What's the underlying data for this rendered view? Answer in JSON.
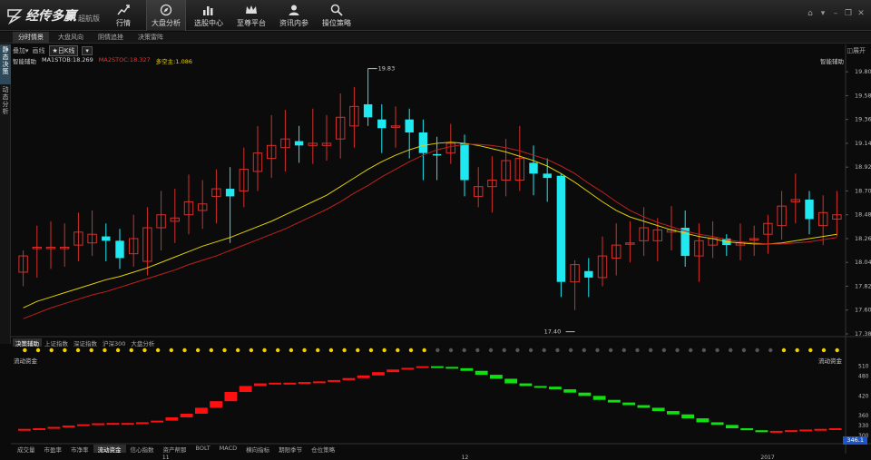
{
  "app": {
    "logo_text": "经传多赢",
    "logo_sub": "超航版"
  },
  "nav": [
    {
      "label": "行情",
      "icon": "chart-up-icon"
    },
    {
      "label": "大盘分析",
      "icon": "compass-icon"
    },
    {
      "label": "选股中心",
      "icon": "bars-icon"
    },
    {
      "label": "至尊平台",
      "icon": "crown-icon"
    },
    {
      "label": "资讯内参",
      "icon": "user-icon"
    },
    {
      "label": "操位策略",
      "icon": "search-icon"
    }
  ],
  "window_controls": [
    "home-icon",
    "menu-icon",
    "minimize-icon",
    "restore-icon",
    "close-icon"
  ],
  "subtabs": [
    "分时情景",
    "大盘风向",
    "阴情追挫",
    "决策雷阵"
  ],
  "left_tabs": [
    "静态决策",
    "动态分析"
  ],
  "toolbar": {
    "overlay": "叠加",
    "overlay_arrow": "▾",
    "lock": "画线",
    "period": "★日K线",
    "expand": "◫展开"
  },
  "indicators": {
    "label": "智能辅助",
    "ma1": "MA1STOB:18.269",
    "ma2": "MA2STOC:18.327",
    "ma3": "多空主:1.086",
    "right": "智能辅助"
  },
  "price_axis": [
    "19.80",
    "19.58",
    "19.36",
    "19.14",
    "18.92",
    "18.70",
    "18.48",
    "18.26",
    "18.04",
    "17.82",
    "17.60",
    "17.38"
  ],
  "annotations": {
    "high": "19.83",
    "low": "17.40"
  },
  "index_tabs": [
    "决策辅助",
    "上证指数",
    "深证指数",
    "沪深300",
    "大盘分析"
  ],
  "flow": {
    "label_left": "流动资金",
    "label_right": "流动资金",
    "axis": [
      "510",
      "480",
      "420",
      "360",
      "330",
      "300"
    ],
    "current": "346.1"
  },
  "time_axis": [
    "11",
    "12",
    "2017"
  ],
  "bottom_tabs": [
    "成交量",
    "市盈率",
    "市净率",
    "流动资金",
    "信心指数",
    "资产帮那",
    "BOLT",
    "MACD",
    "横向指标",
    "期限季节",
    "仓位策略"
  ],
  "colors": {
    "up": "#d4302c",
    "down": "#20e8f0",
    "ma_yellow": "#e0d000",
    "ma_red": "#c02020",
    "flow_up": "#ff1010",
    "flow_down": "#10e010"
  },
  "chart_data": {
    "type": "candlestick",
    "ylim": [
      17.38,
      19.86
    ],
    "candles": [
      [
        17.95,
        18.1,
        17.82,
        18.15
      ],
      [
        18.18,
        18.18,
        17.9,
        18.38
      ],
      [
        18.18,
        18.18,
        17.98,
        18.42
      ],
      [
        18.18,
        18.18,
        18.0,
        18.4
      ],
      [
        18.2,
        18.32,
        18.05,
        18.5
      ],
      [
        18.22,
        18.3,
        18.1,
        18.52
      ],
      [
        18.28,
        18.24,
        18.05,
        18.4
      ],
      [
        18.24,
        18.08,
        17.98,
        18.35
      ],
      [
        18.12,
        18.26,
        18.0,
        18.48
      ],
      [
        18.05,
        18.36,
        17.92,
        18.55
      ],
      [
        18.36,
        18.48,
        18.15,
        18.7
      ],
      [
        18.42,
        18.45,
        18.22,
        18.72
      ],
      [
        18.48,
        18.6,
        18.3,
        18.85
      ],
      [
        18.52,
        18.58,
        18.35,
        18.8
      ],
      [
        18.65,
        18.72,
        18.4,
        18.9
      ],
      [
        18.72,
        18.65,
        18.22,
        18.92
      ],
      [
        18.7,
        18.9,
        18.55,
        19.1
      ],
      [
        18.88,
        19.05,
        18.7,
        19.3
      ],
      [
        19.0,
        19.12,
        18.82,
        19.4
      ],
      [
        19.1,
        19.18,
        18.88,
        19.45
      ],
      [
        19.16,
        19.12,
        18.96,
        19.3
      ],
      [
        19.12,
        19.14,
        18.95,
        19.46
      ],
      [
        19.12,
        19.14,
        18.98,
        19.4
      ],
      [
        19.18,
        19.38,
        19.0,
        19.6
      ],
      [
        19.3,
        19.48,
        19.1,
        19.66
      ],
      [
        19.5,
        19.38,
        19.3,
        19.83
      ],
      [
        19.36,
        19.28,
        19.05,
        19.5
      ],
      [
        19.3,
        19.3,
        19.1,
        19.48
      ],
      [
        19.36,
        19.24,
        19.0,
        19.46
      ],
      [
        19.24,
        19.05,
        18.8,
        19.36
      ],
      [
        19.04,
        19.03,
        18.8,
        19.2
      ],
      [
        19.05,
        19.14,
        18.95,
        19.32
      ],
      [
        19.14,
        18.8,
        18.65,
        19.22
      ],
      [
        18.65,
        18.74,
        18.55,
        18.92
      ],
      [
        18.74,
        18.8,
        18.5,
        19.02
      ],
      [
        18.8,
        18.98,
        18.65,
        19.18
      ],
      [
        18.8,
        19.0,
        18.7,
        19.3
      ],
      [
        18.96,
        18.86,
        18.66,
        19.12
      ],
      [
        18.86,
        18.82,
        18.6,
        19.0
      ],
      [
        18.84,
        17.86,
        17.72,
        18.86
      ],
      [
        17.86,
        18.02,
        17.6,
        18.06
      ],
      [
        17.96,
        17.9,
        17.72,
        18.08
      ],
      [
        17.9,
        18.1,
        17.82,
        18.28
      ],
      [
        18.08,
        18.2,
        17.92,
        18.4
      ],
      [
        18.22,
        18.22,
        18.04,
        18.42
      ],
      [
        18.24,
        18.36,
        18.1,
        18.55
      ],
      [
        18.24,
        18.34,
        18.05,
        18.45
      ],
      [
        18.32,
        18.34,
        18.15,
        18.56
      ],
      [
        18.36,
        18.1,
        18.0,
        18.52
      ],
      [
        18.1,
        18.24,
        17.86,
        18.4
      ],
      [
        18.2,
        18.26,
        18.08,
        18.42
      ],
      [
        18.26,
        18.2,
        18.1,
        18.3
      ],
      [
        18.2,
        18.22,
        18.06,
        18.4
      ],
      [
        18.26,
        18.26,
        18.1,
        18.38
      ],
      [
        18.3,
        18.4,
        18.12,
        18.48
      ],
      [
        18.38,
        18.56,
        18.25,
        18.7
      ],
      [
        18.6,
        18.62,
        18.4,
        18.86
      ],
      [
        18.62,
        18.44,
        18.3,
        18.7
      ],
      [
        18.38,
        18.5,
        18.2,
        18.66
      ],
      [
        18.44,
        18.48,
        18.28,
        18.7
      ]
    ],
    "ma_yellow": [
      17.62,
      17.68,
      17.72,
      17.76,
      17.8,
      17.84,
      17.88,
      17.91,
      17.95,
      17.99,
      18.04,
      18.09,
      18.14,
      18.19,
      18.23,
      18.27,
      18.32,
      18.37,
      18.42,
      18.48,
      18.54,
      18.6,
      18.66,
      18.74,
      18.82,
      18.9,
      18.97,
      19.03,
      19.08,
      19.12,
      19.14,
      19.15,
      19.14,
      19.12,
      19.09,
      19.06,
      19.02,
      18.98,
      18.93,
      18.86,
      18.78,
      18.69,
      18.6,
      18.52,
      18.46,
      18.42,
      18.38,
      18.34,
      18.31,
      18.28,
      18.26,
      18.23,
      18.22,
      18.21,
      18.21,
      18.22,
      18.24,
      18.26,
      18.28,
      18.3
    ],
    "ma_red": [
      17.52,
      17.57,
      17.62,
      17.66,
      17.7,
      17.74,
      17.77,
      17.81,
      17.85,
      17.89,
      17.93,
      17.97,
      18.02,
      18.06,
      18.1,
      18.15,
      18.2,
      18.25,
      18.3,
      18.35,
      18.41,
      18.47,
      18.53,
      18.6,
      18.68,
      18.75,
      18.83,
      18.9,
      18.97,
      19.03,
      19.08,
      19.11,
      19.13,
      19.13,
      19.12,
      19.1,
      19.07,
      19.03,
      18.99,
      18.93,
      18.86,
      18.77,
      18.69,
      18.6,
      18.52,
      18.46,
      18.41,
      18.37,
      18.33,
      18.3,
      18.28,
      18.25,
      18.23,
      18.22,
      18.21,
      18.21,
      18.22,
      18.23,
      18.25,
      18.27
    ],
    "dots": [
      1,
      1,
      1,
      1,
      1,
      1,
      1,
      1,
      1,
      1,
      1,
      1,
      1,
      1,
      1,
      1,
      1,
      1,
      1,
      1,
      1,
      1,
      1,
      1,
      1,
      1,
      1,
      1,
      1,
      1,
      1,
      0,
      0,
      0,
      0,
      0,
      0,
      0,
      0,
      0,
      0,
      0,
      0,
      0,
      0,
      0,
      0,
      0,
      0,
      0,
      0,
      0,
      0,
      0,
      0,
      0,
      0,
      1,
      1,
      1,
      1,
      1
    ],
    "flow": [
      320,
      322,
      326,
      330,
      334,
      337,
      338,
      338,
      340,
      345,
      355,
      366,
      384,
      404,
      432,
      450,
      458,
      460,
      460,
      462,
      464,
      468,
      474,
      482,
      492,
      500,
      505,
      510,
      508,
      504,
      496,
      484,
      472,
      458,
      450,
      448,
      440,
      430,
      420,
      408,
      400,
      392,
      384,
      374,
      364,
      352,
      340,
      332,
      322,
      316,
      310,
      314,
      316,
      318,
      320,
      322
    ],
    "flow_ylim": [
      300,
      520
    ]
  }
}
